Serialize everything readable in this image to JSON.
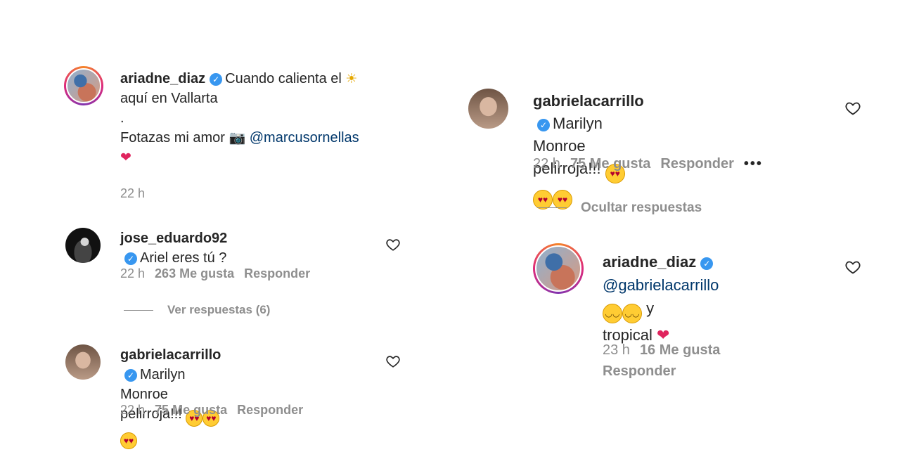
{
  "left": {
    "c1": {
      "username": "ariadne_diaz",
      "line1": "Cuando calienta el",
      "line1_emoji": "☀",
      "line2": "aquí en Vallarta",
      "line3": ".",
      "line4": "Fotazas mi amor",
      "line4_emoji": "📷",
      "mention": "@marcusornellas",
      "line5_emoji": "❤",
      "time": "22 h"
    },
    "c2": {
      "username": "jose_eduardo92",
      "text": "Ariel eres tú ?",
      "time": "22 h",
      "likes": "263 Me gusta",
      "reply": "Responder",
      "view_replies": "Ver respuestas (6)"
    },
    "c3": {
      "username": "gabrielacarrillo",
      "text1": "Marilyn Monroe",
      "text2": "pelirroja!!!",
      "emojis": "😍 😍 😍",
      "time": "22 h",
      "likes": "75 Me gusta",
      "reply": "Responder"
    }
  },
  "right": {
    "c1": {
      "username": "gabrielacarrillo",
      "text1": "Marilyn Monroe",
      "text2": "pelirroja!!!",
      "time": "22 h",
      "likes": "75 Me gusta",
      "reply": "Responder",
      "more": "•••",
      "hide_replies": "Ocultar respuestas"
    },
    "c2": {
      "username": "ariadne_diaz",
      "mention": "@gabrielacarrillo",
      "text_after": "y",
      "text2": "tropical",
      "heart": "❤",
      "time": "23 h",
      "likes": "16 Me gusta",
      "reply": "Responder"
    }
  },
  "icons": {
    "verified": "verified-badge-icon",
    "like": "heart-outline-icon"
  }
}
